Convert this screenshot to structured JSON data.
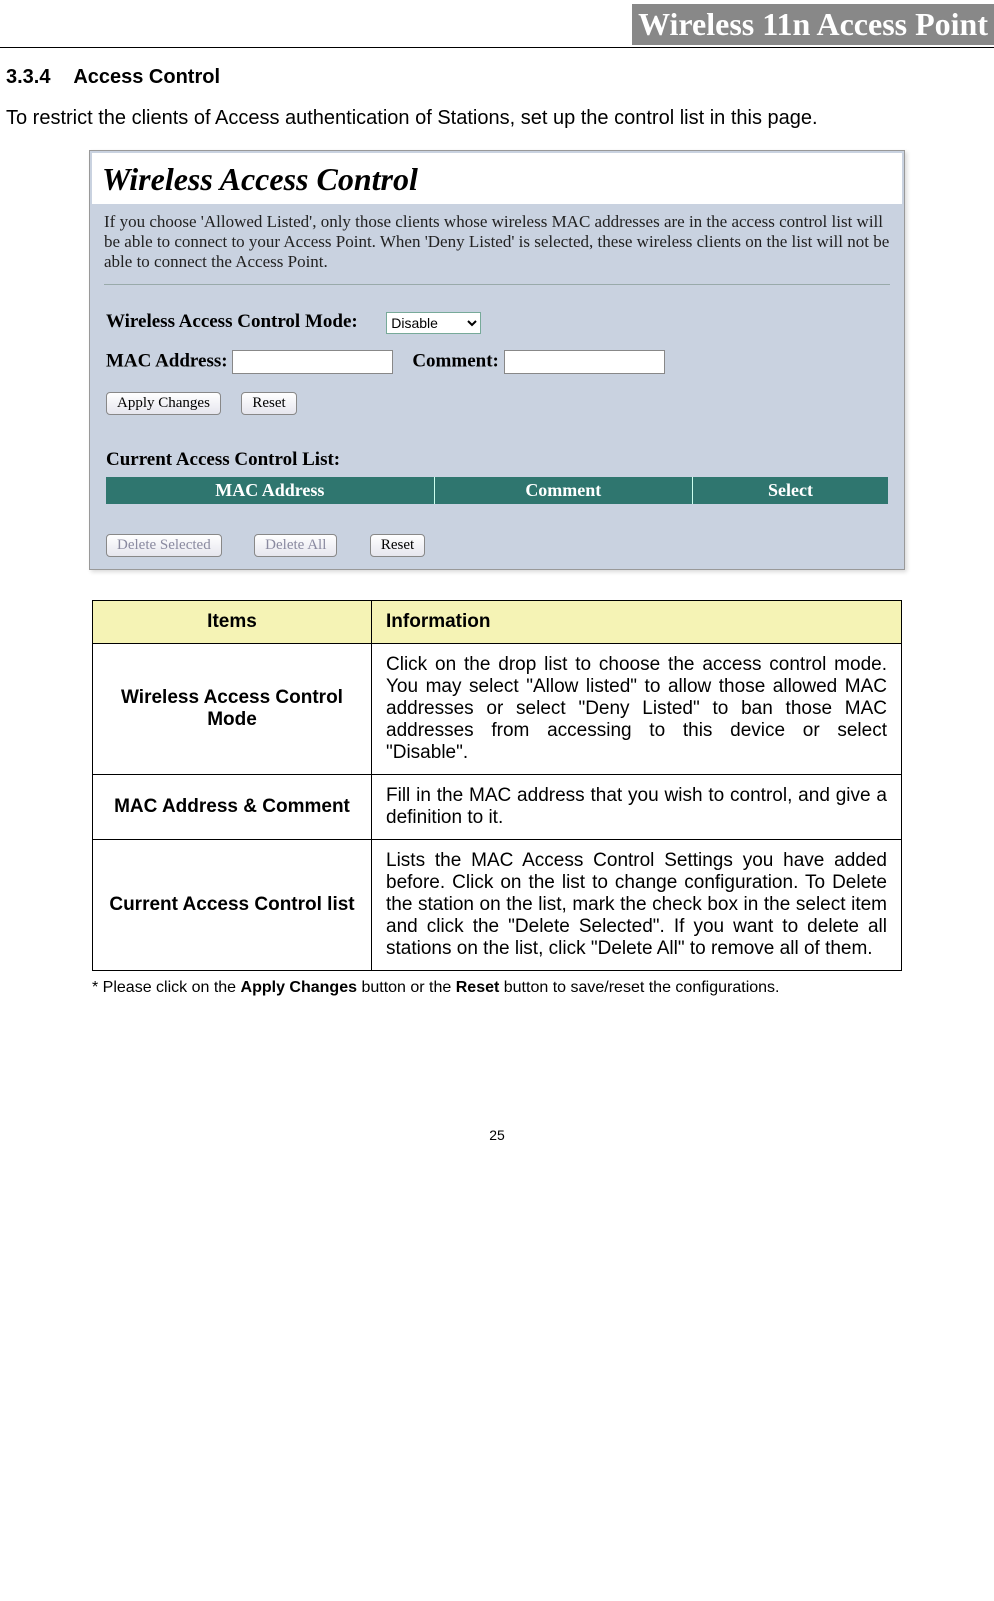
{
  "header": {
    "title": "Wireless 11n Access Point"
  },
  "section": {
    "number": "3.3.4",
    "title": "Access Control",
    "intro": "To restrict the clients of Access authentication of Stations, set up the control list in this page."
  },
  "panel": {
    "title": "Wireless Access Control",
    "desc": "If you choose 'Allowed Listed', only those clients whose wireless MAC addresses are in the access control list will be able to connect to your Access Point. When 'Deny Listed' is selected, these wireless clients on the list will not be able to connect the Access Point.",
    "mode_label": "Wireless Access Control Mode:",
    "mode_value": "Disable",
    "mac_label": "MAC Address:",
    "mac_value": "",
    "comment_label": "Comment:",
    "comment_value": "",
    "apply_btn": "Apply Changes",
    "reset_btn": "Reset",
    "list_heading": "Current Access Control List:",
    "col_mac": "MAC Address",
    "col_comment": "Comment",
    "col_select": "Select",
    "delete_selected_btn": "Delete Selected",
    "delete_all_btn": "Delete All",
    "reset2_btn": "Reset"
  },
  "table": {
    "header_items": "Items",
    "header_info": "Information",
    "rows": [
      {
        "item": "Wireless Access Control Mode",
        "info": "Click on the drop list to choose the access control mode. You may select \"Allow listed\" to allow those allowed MAC addresses or select \"Deny Listed\" to ban those MAC addresses from accessing to this device or select \"Disable\"."
      },
      {
        "item": "MAC Address & Comment",
        "info": "Fill in the MAC address that you wish to control, and give a definition to it."
      },
      {
        "item": "Current Access Control list",
        "info": "Lists the MAC Access Control Settings you have added before. Click on the list to change configuration. To Delete the station on the list, mark the check box in the select item and click the \"Delete Selected\". If you want to delete all stations on the list, click \"Delete All\" to remove all of them."
      }
    ]
  },
  "footnote": {
    "prefix": "* Please click on the ",
    "b1": "Apply Changes",
    "mid": " button or the ",
    "b2": "Reset",
    "suffix": " button to save/reset the configurations."
  },
  "page_number": "25"
}
